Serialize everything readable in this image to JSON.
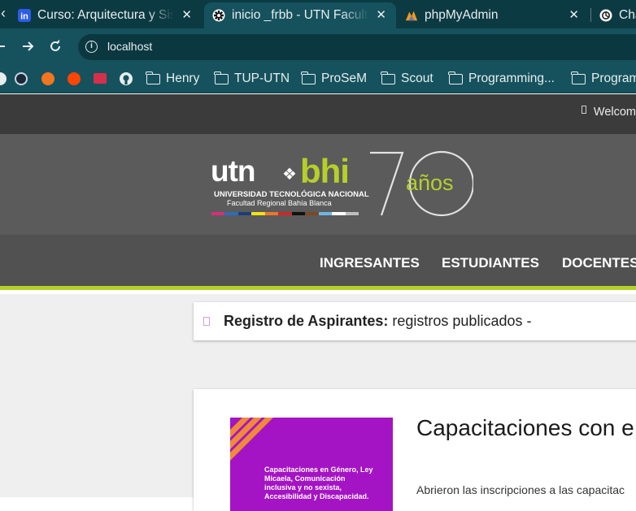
{
  "browser": {
    "tabs": [
      {
        "title": "Curso: Arquitectura y Sistemas Operativos",
        "favicon": "udemy-style-favicon",
        "active": false
      },
      {
        "title": "inicio _frbb - UTN Facultad Regional Bahía Blanca",
        "favicon": "utn-favicon",
        "active": true
      },
      {
        "title": "phpMyAdmin",
        "favicon": "phpmyadmin-favicon",
        "active": false
      },
      {
        "title": "Cha",
        "favicon": "chatgpt-favicon",
        "active": false
      }
    ],
    "close_glyph": "✕",
    "address": "localhost",
    "bookmarks": [
      "Henry",
      "TUP-UTN",
      "ProSeM",
      "Scout",
      "Programming...",
      "Program"
    ],
    "bookmark_icons": [
      "steam-icon",
      "crunchyroll-icon",
      "reddit-icon",
      "ymail-icon",
      "github-icon"
    ]
  },
  "site": {
    "welcome": "Welcom",
    "logo": {
      "utn": "utn",
      "bhi": "bhi",
      "line1": "UNIVERSIDAD TECNOLÓGICA NACIONAL",
      "line2": "Facultad Regional Bahía Blanca",
      "seventy": "70",
      "anos": "años",
      "accent": "#b6cf2a"
    },
    "nav": [
      "INGRESANTES",
      "ESTUDIANTES",
      "DOCENTES"
    ],
    "notice": {
      "label": "Registro de Aspirantes:",
      "text": " registros publicados -"
    },
    "card": {
      "title": "Capacitaciones con e",
      "image_text": "Capacitaciones en Género, Ley Micaela, Comunicación inclusiva y no sexista, Accesibilidad y Discapacidad.",
      "excerpt": "Abrieron las inscripciones a las capacitac"
    }
  }
}
